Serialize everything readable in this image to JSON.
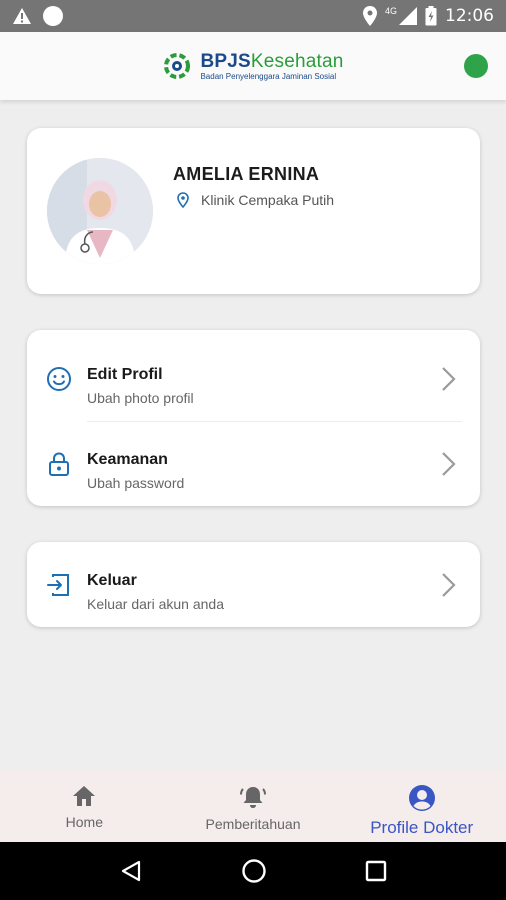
{
  "status_bar": {
    "time": "12:06",
    "network": "4G"
  },
  "header": {
    "logo_main_a": "BPJS",
    "logo_main_b": "Kesehatan",
    "logo_sub": "Badan Penyelenggara Jaminan Sosial",
    "status_color": "#2ea34a"
  },
  "profile": {
    "name": "AMELIA ERNINA",
    "clinic": "Klinik Cempaka Putih"
  },
  "menu": [
    {
      "title": "Edit Profil",
      "subtitle": "Ubah photo profil",
      "icon": "smile-icon"
    },
    {
      "title": "Keamanan",
      "subtitle": "Ubah password",
      "icon": "lock-icon"
    }
  ],
  "logout": {
    "title": "Keluar",
    "subtitle": "Keluar dari akun anda",
    "icon": "logout-icon"
  },
  "bottom_nav": [
    {
      "label": "Home",
      "icon": "home-icon"
    },
    {
      "label": "Pemberitahuan",
      "icon": "bell-icon"
    },
    {
      "label": "Profile Dokter",
      "icon": "account-circle-icon"
    }
  ],
  "colors": {
    "accent": "#3a55c4",
    "icon_blue": "#1f6fb5",
    "brand_blue": "#1a4a8a",
    "brand_green": "#2a9d3a"
  }
}
